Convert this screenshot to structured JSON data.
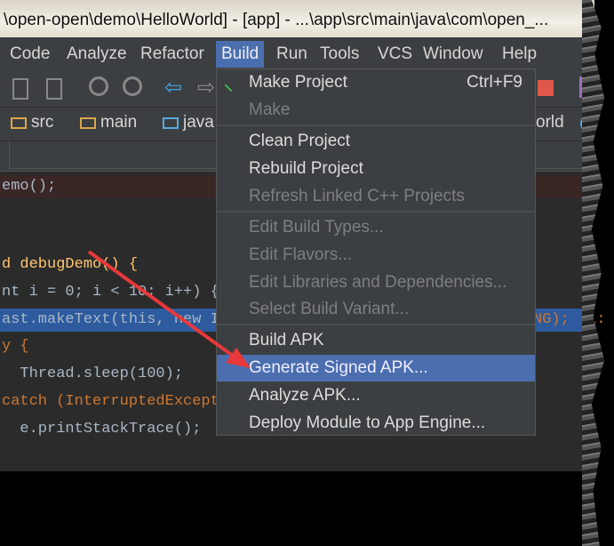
{
  "window": {
    "title": "\\open-open\\demo\\HelloWorld] - [app] - ...\\app\\src\\main\\java\\com\\open_..."
  },
  "menubar": [
    {
      "label": "Code"
    },
    {
      "label": "Analyze"
    },
    {
      "label": "Refactor"
    },
    {
      "label": "Build",
      "active": true
    },
    {
      "label": "Run"
    },
    {
      "label": "Tools"
    },
    {
      "label": "VCS"
    },
    {
      "label": "Window"
    },
    {
      "label": "Help"
    }
  ],
  "breadcrumb": [
    {
      "label": "src"
    },
    {
      "label": "main"
    },
    {
      "label": "java"
    },
    {
      "label": "orld"
    }
  ],
  "code": {
    "lines": [
      "emo();",
      "d debugDemo() {",
      "nt i = 0; i < 10; i++) {",
      "ast.makeText(this, new In",
      "y {",
      "  Thread.sleep(100);",
      "catch (InterruptedExcepti",
      "  e.printStackTrace();"
    ],
    "tail": "NG);  i:"
  },
  "build_menu": {
    "items": [
      {
        "label": "Make Project",
        "shortcut": "Ctrl+F9",
        "icon": "hammer-icon"
      },
      {
        "label": "Make",
        "disabled": true
      },
      {
        "separator": true
      },
      {
        "label": "Clean Project"
      },
      {
        "label": "Rebuild Project"
      },
      {
        "label": "Refresh Linked C++ Projects",
        "disabled": true
      },
      {
        "separator": true
      },
      {
        "label": "Edit Build Types...",
        "disabled": true
      },
      {
        "label": "Edit Flavors...",
        "disabled": true
      },
      {
        "label": "Edit Libraries and Dependencies...",
        "disabled": true
      },
      {
        "label": "Select Build Variant...",
        "disabled": true
      },
      {
        "separator": true
      },
      {
        "label": "Build APK"
      },
      {
        "label": "Generate Signed APK...",
        "selected": true
      },
      {
        "label": "Analyze APK..."
      },
      {
        "label": "Deploy Module to App Engine..."
      }
    ]
  },
  "colors": {
    "menu_highlight": "#4b6eaf",
    "arrow": "#e8383a",
    "editor_bg": "#2b2b2b"
  }
}
